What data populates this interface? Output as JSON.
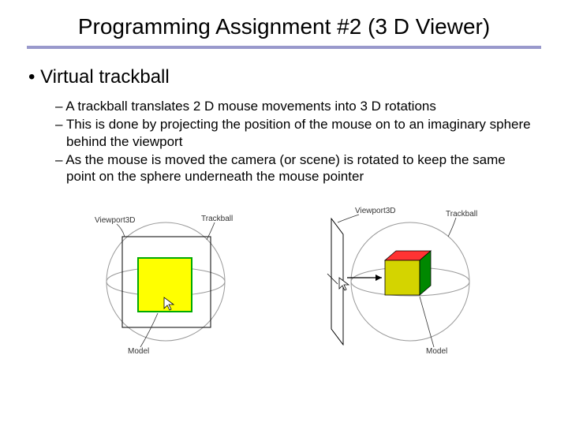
{
  "title": "Programming Assignment #2 (3 D Viewer)",
  "heading": "Virtual trackball",
  "bullets": [
    "A trackball translates 2 D mouse movements into 3 D rotations",
    "This is done by projecting the position of the mouse on to an imaginary sphere behind the viewport",
    "As the mouse is moved the camera (or scene) is rotated to keep the same point on the sphere underneath the mouse pointer"
  ],
  "labels": {
    "viewport": "Viewport3D",
    "trackball": "Trackball",
    "model": "Model"
  },
  "colors": {
    "underline": "#9999cc",
    "square_fill": "#ffff00",
    "square_stroke": "#00aa00",
    "cube_top": "#ff3333",
    "cube_front": "#cccc00",
    "cube_side": "#008800"
  }
}
